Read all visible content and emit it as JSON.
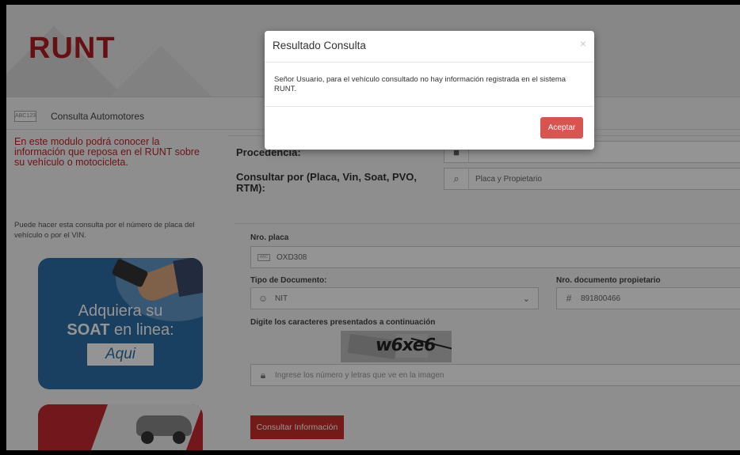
{
  "header": {
    "logo_text": "RUNT"
  },
  "breadcrumb": {
    "icon_text": "ABC123",
    "label": "Consulta Automotores"
  },
  "sidebar": {
    "intro": "En este modulo podrá conocer la información que reposa en el RUNT sobre su vehículo o motocicleta.",
    "hint": "Puede hacer esta consulta por el número de placa del vehículo o por el VIN.",
    "soat_banner": {
      "line1": "Adquiera su",
      "line2_bold": "SOAT",
      "line2_rest": " en linea:",
      "button": "Aqui"
    }
  },
  "form": {
    "procedencia_label": "Procedencia:",
    "consultar_por_label": "Consultar por (Placa, Vin, Soat, PVO, RTM):",
    "consultar_por_value": "Placa y Propietario",
    "placa_label": "Nro. placa",
    "placa_value": "OXD308",
    "tipo_doc_label": "Tipo de Documento:",
    "tipo_doc_value": "NIT",
    "nro_doc_label": "Nro. documento propietario",
    "nro_doc_value": "891800466",
    "captcha_label": "Digite los caracteres presentados a continuación",
    "captcha_text": "w6xe6",
    "captcha_placeholder": "Ingrese los número y letras que ve en la imagen",
    "submit_label": "Consultar Información"
  },
  "modal": {
    "title": "Resultado Consulta",
    "close": "×",
    "message": "Señor Usuario, para el vehículo consultado no hay información registrada en el sistema RUNT.",
    "ok_label": "Aceptar"
  },
  "colors": {
    "brand_red": "#b11c23",
    "button_red": "#c9302c",
    "modal_ok": "#d9534f",
    "soat_blue": "#2d6fa8"
  }
}
